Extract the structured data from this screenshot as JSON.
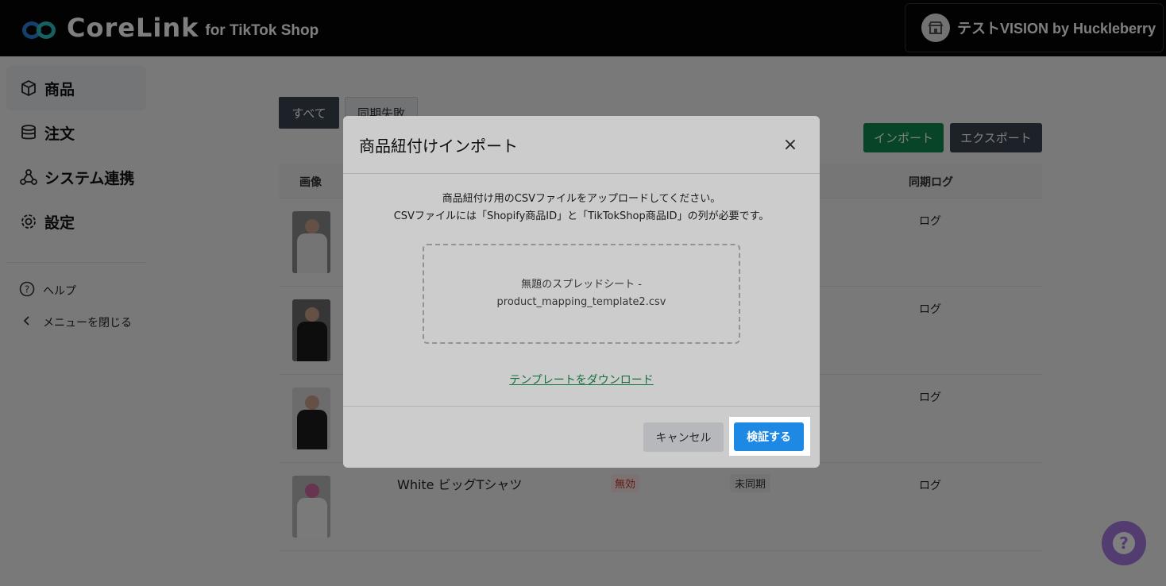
{
  "header": {
    "brand": "CoreLink",
    "brand_sub": "for TikTok Shop",
    "shop_name": "テストVISION by Huckleberry"
  },
  "sidebar": {
    "items": [
      {
        "label": "商品",
        "icon": "box-icon",
        "active": true
      },
      {
        "label": "注文",
        "icon": "database-icon",
        "active": false
      },
      {
        "label": "システム連携",
        "icon": "network-icon",
        "active": false
      },
      {
        "label": "設定",
        "icon": "gear-icon",
        "active": false
      }
    ],
    "help_label": "ヘルプ",
    "close_menu_label": "メニューを閉じる"
  },
  "main": {
    "tabs": [
      "すべて",
      "同期失敗"
    ],
    "import_label": "インポート",
    "export_label": "エクスポート",
    "columns": {
      "image": "画像",
      "sync_log": "同期ログ"
    },
    "rows": [
      {
        "log": "ログ"
      },
      {
        "log": "ログ"
      },
      {
        "log": "ログ"
      },
      {
        "name": "White ビッグTシャツ",
        "status": "無効",
        "sync": "未同期",
        "log": "ログ"
      }
    ]
  },
  "modal": {
    "title": "商品紐付けインポート",
    "close": "×",
    "desc_line1": "商品紐付け用のCSVファイルをアップロードしてください。",
    "desc_line2": "CSVファイルには「Shopify商品ID」と「TikTokShop商品ID」の列が必要です。",
    "file_line1": "無題のスプレッドシート -",
    "file_line2": "product_mapping_template2.csv",
    "template_link": "テンプレートをダウンロード",
    "cancel_label": "キャンセル",
    "verify_label": "検証する"
  },
  "colors": {
    "header_bg": "#050505",
    "import_green": "#0f8a4c",
    "verify_blue": "#1e88e5",
    "chat_purple": "#a779e0",
    "link_green": "#1a8f4e"
  }
}
